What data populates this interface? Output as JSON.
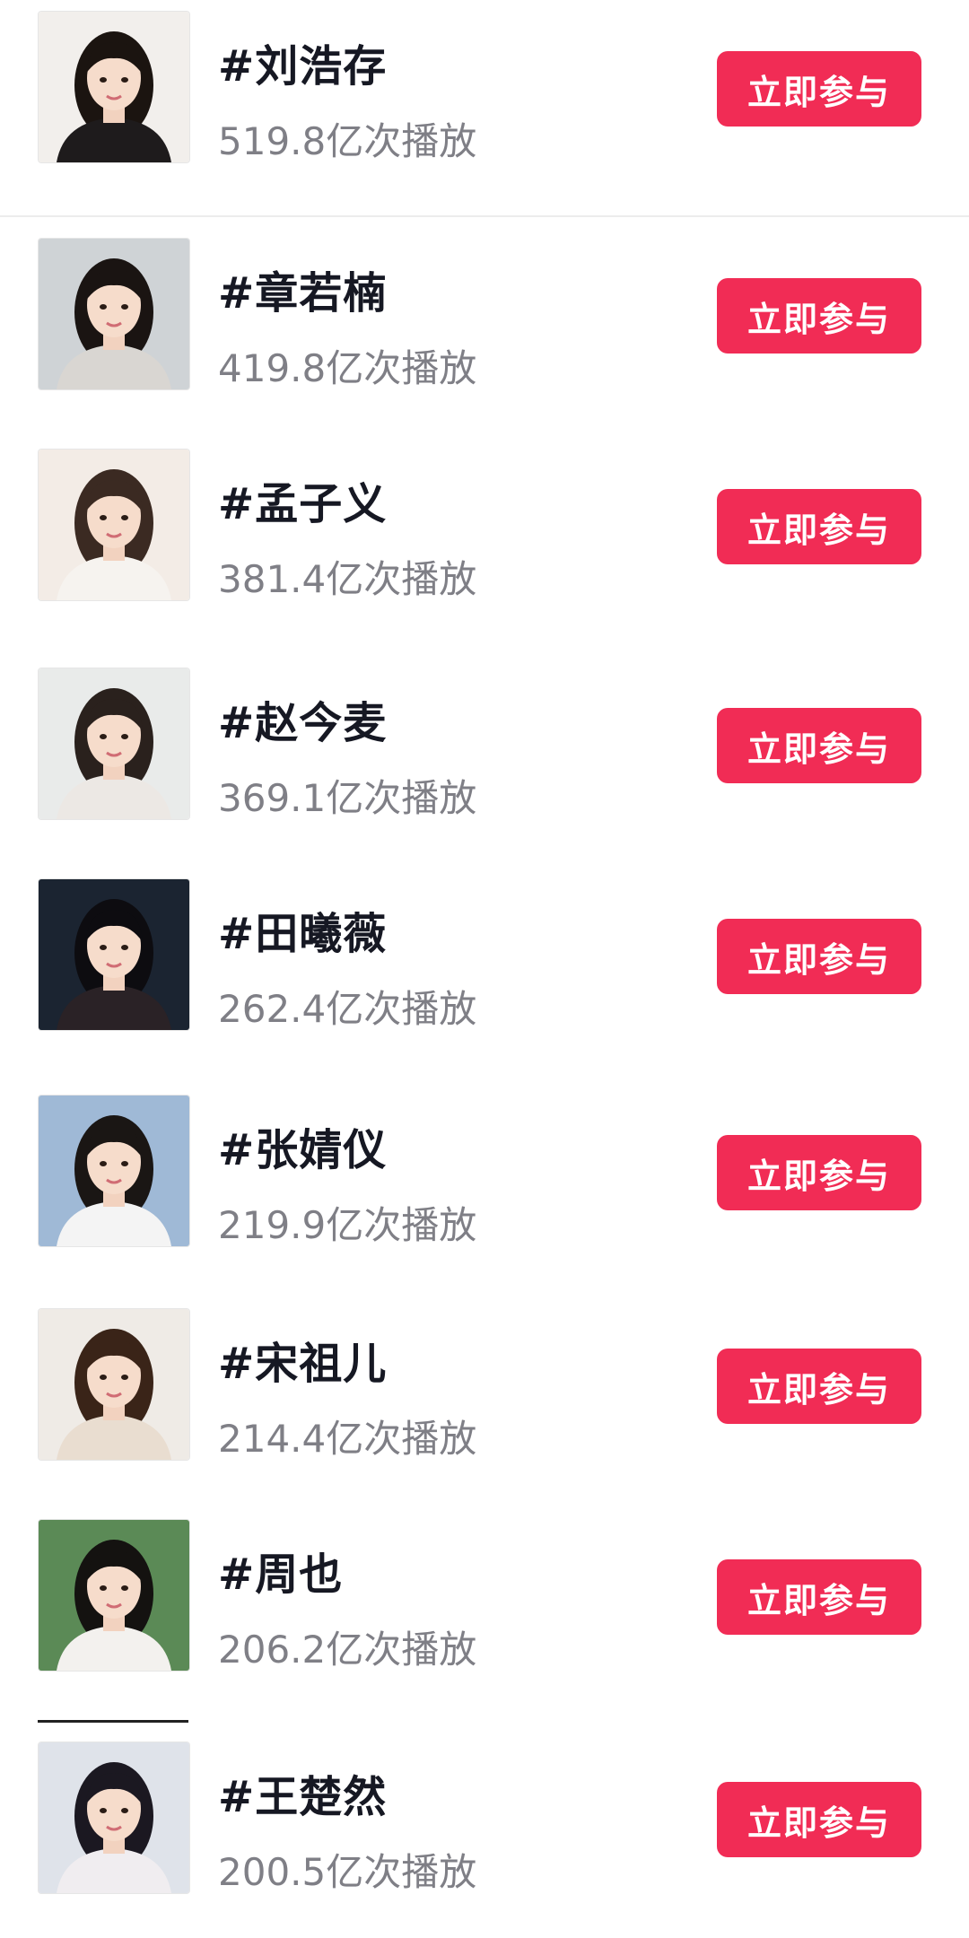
{
  "items": [
    {
      "topic": "#刘浩存",
      "plays": "519.8亿次播放",
      "button": "立即参与",
      "avatar": "portrait-photo",
      "bg": "#f2efec",
      "hair": "#1b1410",
      "shirt": "#1e1b1c"
    },
    {
      "topic": "#章若楠",
      "plays": "419.8亿次播放",
      "button": "立即参与",
      "avatar": "portrait-photo",
      "bg": "#cfd3d6",
      "hair": "#1a1412",
      "shirt": "#d9d6d2"
    },
    {
      "topic": "#孟子义",
      "plays": "381.4亿次播放",
      "button": "立即参与",
      "avatar": "portrait-photo",
      "bg": "#f3ece6",
      "hair": "#3b2a22",
      "shirt": "#f6f3ef"
    },
    {
      "topic": "#赵今麦",
      "plays": "369.1亿次播放",
      "button": "立即参与",
      "avatar": "portrait-photo",
      "bg": "#e9ebea",
      "hair": "#2a211d",
      "shirt": "#ece8e4"
    },
    {
      "topic": "#田曦薇",
      "plays": "262.4亿次播放",
      "button": "立即参与",
      "avatar": "portrait-photo",
      "bg": "#1b2431",
      "hair": "#0d0c10",
      "shirt": "#2a2226"
    },
    {
      "topic": "#张婧仪",
      "plays": "219.9亿次播放",
      "button": "立即参与",
      "avatar": "portrait-photo",
      "bg": "#9fb9d6",
      "hair": "#1a1614",
      "shirt": "#f4f4f4"
    },
    {
      "topic": "#宋祖儿",
      "plays": "214.4亿次播放",
      "button": "立即参与",
      "avatar": "portrait-photo",
      "bg": "#efebe6",
      "hair": "#3a2418",
      "shirt": "#e9ddd0"
    },
    {
      "topic": "#周也",
      "plays": "206.2亿次播放",
      "button": "立即参与",
      "avatar": "portrait-photo",
      "bg": "#5b8a56",
      "hair": "#141210",
      "shirt": "#f3f1ee"
    },
    {
      "topic": "#王楚然",
      "plays": "200.5亿次播放",
      "button": "立即参与",
      "avatar": "portrait-photo",
      "bg": "#dfe3ea",
      "hair": "#1b1821",
      "shirt": "#f0edf0"
    }
  ],
  "colors": {
    "accent": "#f12c55",
    "title": "#161823",
    "subtitle": "#7f7f86"
  }
}
